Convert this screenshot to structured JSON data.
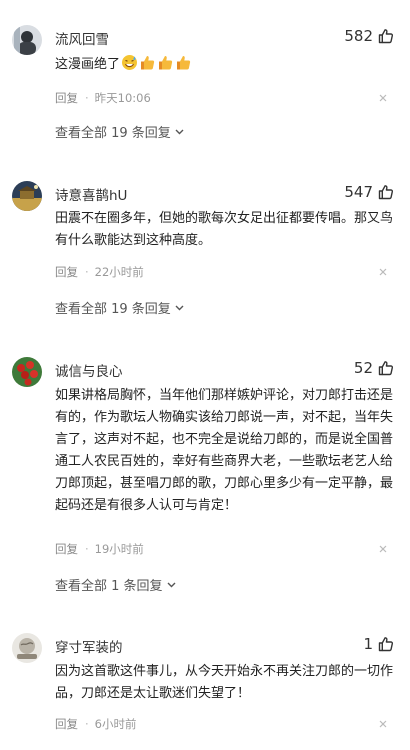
{
  "comments": [
    {
      "username": "流风回雪",
      "likes": "582",
      "text": "这漫画绝了",
      "emojis": [
        "sweat-smile-icon",
        "thumbs-up-icon",
        "thumbs-up-icon",
        "thumbs-up-icon"
      ],
      "reply_label": "回复",
      "time": "昨天10:06",
      "more_replies": "查看全部 19 条回复"
    },
    {
      "username": "诗意喜鹊hU",
      "likes": "547",
      "text": "田震不在圈多年，但她的歌每次女足出征都要传唱。那又鸟有什么歌能达到这种高度。",
      "reply_label": "回复",
      "time": "22小时前",
      "more_replies": "查看全部 19 条回复"
    },
    {
      "username": "诚信与良心",
      "likes": "52",
      "text": "如果讲格局胸怀，当年他们那样嫉妒评论，对刀郎打击还是有的，作为歌坛人物确实该给刀郎说一声，对不起，当年失言了，这声对不起，也不完全是说给刀郎的，而是说全国普通工人农民百姓的，幸好有些商界大老，一些歌坛老艺人给刀郎顶起，甚至唱刀郎的歌，刀郎心里多少有一定平静，最起码还是有很多人认可与肯定！",
      "reply_label": "回复",
      "time": "19小时前",
      "more_replies": "查看全部 1 条回复"
    },
    {
      "username": "穿寸军装的",
      "likes": "1",
      "text": "因为这首歌这件事儿，从今天开始永不再关注刀郎的一切作品，刀郎还是太让歌迷们失望了！",
      "reply_label": "回复",
      "time": "6小时前"
    }
  ],
  "icons": {
    "like": "thumbs-up-outline-icon",
    "close": "close-icon",
    "expand": "chevron-down-icon"
  },
  "colors": {
    "text": "#222222",
    "meta": "#999999",
    "more": "#555555"
  }
}
